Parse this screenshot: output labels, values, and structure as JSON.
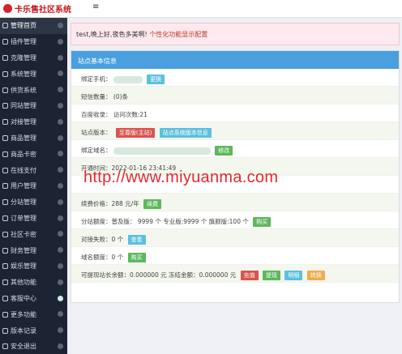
{
  "header": {
    "logo_text": "卡乐售社区系统",
    "menu_toggle": "≡"
  },
  "sidebar": {
    "items": [
      {
        "label": "管理首页",
        "active": true
      },
      {
        "label": "插件管理"
      },
      {
        "label": "克隆管理"
      },
      {
        "label": "系统管理"
      },
      {
        "label": "供货系统"
      },
      {
        "label": "同站管理"
      },
      {
        "label": "对接管理"
      },
      {
        "label": "商品管理"
      },
      {
        "label": "商品卡密"
      },
      {
        "label": "在线支付"
      },
      {
        "label": "用户管理"
      },
      {
        "label": "分站管理"
      },
      {
        "label": "订单管理"
      },
      {
        "label": "社区卡密"
      },
      {
        "label": "财务管理"
      },
      {
        "label": "娱乐管理"
      },
      {
        "label": "其他功能"
      },
      {
        "label": "客服中心",
        "dot": true
      },
      {
        "label": "更多功能"
      },
      {
        "label": "版本记录"
      },
      {
        "label": "安全退出"
      }
    ]
  },
  "notice": {
    "greeting": "test,晚上好,夜色多美啊! ",
    "link": "个性化功能显示配置"
  },
  "panel": {
    "title": "站点基本信息",
    "rows": {
      "phone": {
        "label": "绑定手机：",
        "tag": "更换"
      },
      "sms": {
        "label": "短信数量： (0)条"
      },
      "baidu": {
        "label": "百度收录： 访问次数:21"
      },
      "version": {
        "label": "站点版本：",
        "tag1": "至尊版(主站)",
        "tag2": "站点系统版本信息"
      },
      "domain": {
        "label": "绑定域名：",
        "tag": "修改"
      },
      "opened": {
        "label": "开通时间：2022-01-16 23:41:49"
      },
      "renew": {
        "label": "续费价格：288 元/年",
        "tag": "续费"
      },
      "quota": {
        "label": "分站额度：普及版： 9999 个 专业版:9999 个 旗舰版:100 个",
        "tag": "购买"
      },
      "failed": {
        "label": "对接失败：0 个",
        "tag": "查看"
      },
      "domain_quota": {
        "label": "域名额度：0 个",
        "tag": "购买"
      },
      "balance": {
        "label": "可提现站长余额：0.000000 元 冻结金额：0.000000 元",
        "tags": [
          "充值",
          "提现",
          "明细",
          "转换"
        ]
      }
    }
  },
  "watermark": "http://www.miyuanma.com"
}
